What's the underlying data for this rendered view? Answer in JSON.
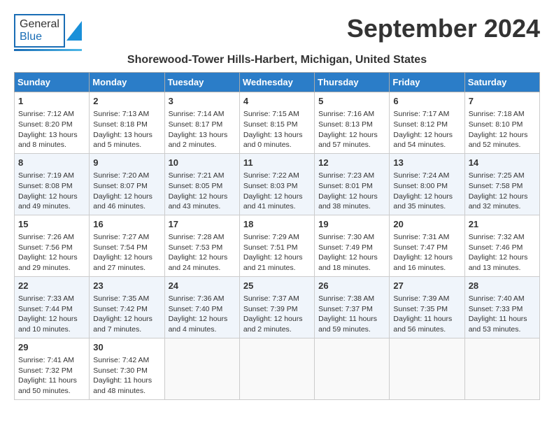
{
  "logo": {
    "general": "General",
    "blue": "Blue"
  },
  "title": "September 2024",
  "subtitle": "Shorewood-Tower Hills-Harbert, Michigan, United States",
  "days": [
    "Sunday",
    "Monday",
    "Tuesday",
    "Wednesday",
    "Thursday",
    "Friday",
    "Saturday"
  ],
  "weeks": [
    [
      {
        "day": "1",
        "sunrise": "Sunrise: 7:12 AM",
        "sunset": "Sunset: 8:20 PM",
        "daylight": "Daylight: 13 hours and 8 minutes."
      },
      {
        "day": "2",
        "sunrise": "Sunrise: 7:13 AM",
        "sunset": "Sunset: 8:18 PM",
        "daylight": "Daylight: 13 hours and 5 minutes."
      },
      {
        "day": "3",
        "sunrise": "Sunrise: 7:14 AM",
        "sunset": "Sunset: 8:17 PM",
        "daylight": "Daylight: 13 hours and 2 minutes."
      },
      {
        "day": "4",
        "sunrise": "Sunrise: 7:15 AM",
        "sunset": "Sunset: 8:15 PM",
        "daylight": "Daylight: 13 hours and 0 minutes."
      },
      {
        "day": "5",
        "sunrise": "Sunrise: 7:16 AM",
        "sunset": "Sunset: 8:13 PM",
        "daylight": "Daylight: 12 hours and 57 minutes."
      },
      {
        "day": "6",
        "sunrise": "Sunrise: 7:17 AM",
        "sunset": "Sunset: 8:12 PM",
        "daylight": "Daylight: 12 hours and 54 minutes."
      },
      {
        "day": "7",
        "sunrise": "Sunrise: 7:18 AM",
        "sunset": "Sunset: 8:10 PM",
        "daylight": "Daylight: 12 hours and 52 minutes."
      }
    ],
    [
      {
        "day": "8",
        "sunrise": "Sunrise: 7:19 AM",
        "sunset": "Sunset: 8:08 PM",
        "daylight": "Daylight: 12 hours and 49 minutes."
      },
      {
        "day": "9",
        "sunrise": "Sunrise: 7:20 AM",
        "sunset": "Sunset: 8:07 PM",
        "daylight": "Daylight: 12 hours and 46 minutes."
      },
      {
        "day": "10",
        "sunrise": "Sunrise: 7:21 AM",
        "sunset": "Sunset: 8:05 PM",
        "daylight": "Daylight: 12 hours and 43 minutes."
      },
      {
        "day": "11",
        "sunrise": "Sunrise: 7:22 AM",
        "sunset": "Sunset: 8:03 PM",
        "daylight": "Daylight: 12 hours and 41 minutes."
      },
      {
        "day": "12",
        "sunrise": "Sunrise: 7:23 AM",
        "sunset": "Sunset: 8:01 PM",
        "daylight": "Daylight: 12 hours and 38 minutes."
      },
      {
        "day": "13",
        "sunrise": "Sunrise: 7:24 AM",
        "sunset": "Sunset: 8:00 PM",
        "daylight": "Daylight: 12 hours and 35 minutes."
      },
      {
        "day": "14",
        "sunrise": "Sunrise: 7:25 AM",
        "sunset": "Sunset: 7:58 PM",
        "daylight": "Daylight: 12 hours and 32 minutes."
      }
    ],
    [
      {
        "day": "15",
        "sunrise": "Sunrise: 7:26 AM",
        "sunset": "Sunset: 7:56 PM",
        "daylight": "Daylight: 12 hours and 29 minutes."
      },
      {
        "day": "16",
        "sunrise": "Sunrise: 7:27 AM",
        "sunset": "Sunset: 7:54 PM",
        "daylight": "Daylight: 12 hours and 27 minutes."
      },
      {
        "day": "17",
        "sunrise": "Sunrise: 7:28 AM",
        "sunset": "Sunset: 7:53 PM",
        "daylight": "Daylight: 12 hours and 24 minutes."
      },
      {
        "day": "18",
        "sunrise": "Sunrise: 7:29 AM",
        "sunset": "Sunset: 7:51 PM",
        "daylight": "Daylight: 12 hours and 21 minutes."
      },
      {
        "day": "19",
        "sunrise": "Sunrise: 7:30 AM",
        "sunset": "Sunset: 7:49 PM",
        "daylight": "Daylight: 12 hours and 18 minutes."
      },
      {
        "day": "20",
        "sunrise": "Sunrise: 7:31 AM",
        "sunset": "Sunset: 7:47 PM",
        "daylight": "Daylight: 12 hours and 16 minutes."
      },
      {
        "day": "21",
        "sunrise": "Sunrise: 7:32 AM",
        "sunset": "Sunset: 7:46 PM",
        "daylight": "Daylight: 12 hours and 13 minutes."
      }
    ],
    [
      {
        "day": "22",
        "sunrise": "Sunrise: 7:33 AM",
        "sunset": "Sunset: 7:44 PM",
        "daylight": "Daylight: 12 hours and 10 minutes."
      },
      {
        "day": "23",
        "sunrise": "Sunrise: 7:35 AM",
        "sunset": "Sunset: 7:42 PM",
        "daylight": "Daylight: 12 hours and 7 minutes."
      },
      {
        "day": "24",
        "sunrise": "Sunrise: 7:36 AM",
        "sunset": "Sunset: 7:40 PM",
        "daylight": "Daylight: 12 hours and 4 minutes."
      },
      {
        "day": "25",
        "sunrise": "Sunrise: 7:37 AM",
        "sunset": "Sunset: 7:39 PM",
        "daylight": "Daylight: 12 hours and 2 minutes."
      },
      {
        "day": "26",
        "sunrise": "Sunrise: 7:38 AM",
        "sunset": "Sunset: 7:37 PM",
        "daylight": "Daylight: 11 hours and 59 minutes."
      },
      {
        "day": "27",
        "sunrise": "Sunrise: 7:39 AM",
        "sunset": "Sunset: 7:35 PM",
        "daylight": "Daylight: 11 hours and 56 minutes."
      },
      {
        "day": "28",
        "sunrise": "Sunrise: 7:40 AM",
        "sunset": "Sunset: 7:33 PM",
        "daylight": "Daylight: 11 hours and 53 minutes."
      }
    ],
    [
      {
        "day": "29",
        "sunrise": "Sunrise: 7:41 AM",
        "sunset": "Sunset: 7:32 PM",
        "daylight": "Daylight: 11 hours and 50 minutes."
      },
      {
        "day": "30",
        "sunrise": "Sunrise: 7:42 AM",
        "sunset": "Sunset: 7:30 PM",
        "daylight": "Daylight: 11 hours and 48 minutes."
      },
      null,
      null,
      null,
      null,
      null
    ]
  ]
}
